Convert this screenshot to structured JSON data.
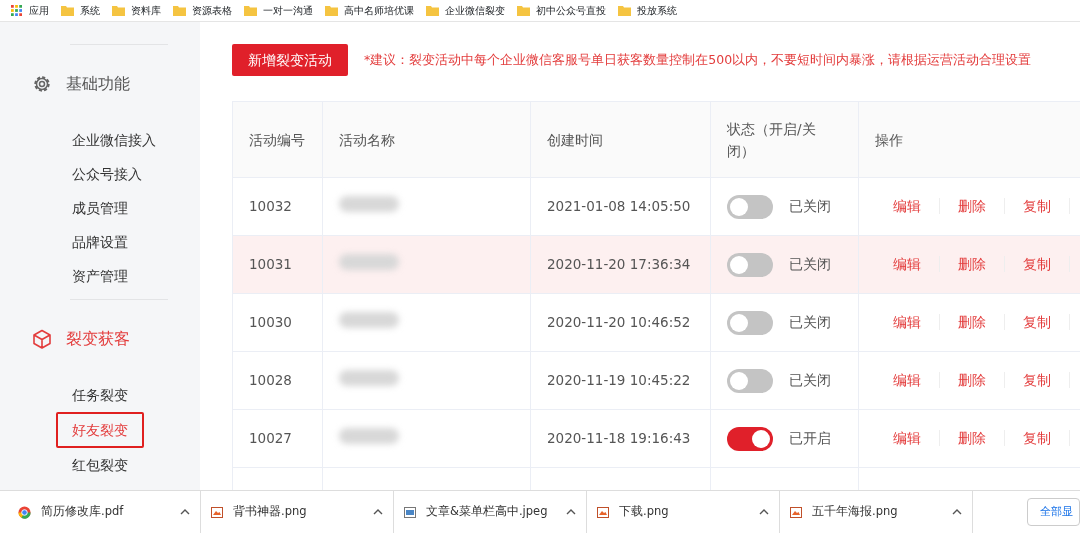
{
  "bookmarks": [
    {
      "label": "应用",
      "kind": "apps"
    },
    {
      "label": "系统",
      "kind": "folder"
    },
    {
      "label": "资料库",
      "kind": "folder"
    },
    {
      "label": "资源表格",
      "kind": "folder"
    },
    {
      "label": "一对一沟通",
      "kind": "folder"
    },
    {
      "label": "高中名师培优课",
      "kind": "folder"
    },
    {
      "label": "企业微信裂变",
      "kind": "folder"
    },
    {
      "label": "初中公众号直投",
      "kind": "folder"
    },
    {
      "label": "投放系统",
      "kind": "folder"
    }
  ],
  "sidebar": {
    "groups": [
      {
        "title": "基础功能",
        "kind": "settings",
        "active": false,
        "items": [
          {
            "label": "企业微信接入",
            "selected": false
          },
          {
            "label": "公众号接入",
            "selected": false
          },
          {
            "label": "成员管理",
            "selected": false
          },
          {
            "label": "品牌设置",
            "selected": false
          },
          {
            "label": "资产管理",
            "selected": false
          }
        ]
      },
      {
        "title": "裂变获客",
        "kind": "acquisition",
        "active": true,
        "items": [
          {
            "label": "任务裂变",
            "selected": false
          },
          {
            "label": "好友裂变",
            "selected": true
          },
          {
            "label": "红包裂变",
            "selected": false
          }
        ]
      }
    ]
  },
  "toolbar": {
    "button": "新增裂变活动",
    "notice": "*建议：裂变活动中每个企业微信客服号单日获客数量控制在500以内，不要短时间内暴涨，请根据运营活动合理设置"
  },
  "table": {
    "columns": [
      "活动编号",
      "活动名称",
      "创建时间",
      "状态（开启/关闭）",
      "操作"
    ],
    "rows": [
      {
        "id": "10032",
        "created": "2021-01-08 14:05:50",
        "on": false,
        "status": "已关闭",
        "highlighted": false,
        "actions": [
          "编辑",
          "删除",
          "复制"
        ]
      },
      {
        "id": "10031",
        "created": "2020-11-20 17:36:34",
        "on": false,
        "status": "已关闭",
        "highlighted": true,
        "actions": [
          "编辑",
          "删除",
          "复制"
        ]
      },
      {
        "id": "10030",
        "created": "2020-11-20 10:46:52",
        "on": false,
        "status": "已关闭",
        "highlighted": false,
        "actions": [
          "编辑",
          "删除",
          "复制"
        ]
      },
      {
        "id": "10028",
        "created": "2020-11-19 10:45:22",
        "on": false,
        "status": "已关闭",
        "highlighted": false,
        "actions": [
          "编辑",
          "删除",
          "复制"
        ]
      },
      {
        "id": "10027",
        "created": "2020-11-18 19:16:43",
        "on": true,
        "status": "已开启",
        "highlighted": false,
        "actions": [
          "编辑",
          "删除",
          "复制"
        ]
      }
    ]
  },
  "downloads": {
    "items": [
      {
        "name": "简历修改库.pdf",
        "kind": "pdf"
      },
      {
        "name": "背书神器.png",
        "kind": "image"
      },
      {
        "name": "文章&菜单栏高中.jpeg",
        "kind": "photo"
      },
      {
        "name": "下载.png",
        "kind": "image"
      },
      {
        "name": "五千年海报.png",
        "kind": "image"
      }
    ],
    "show_all": "全部显"
  }
}
